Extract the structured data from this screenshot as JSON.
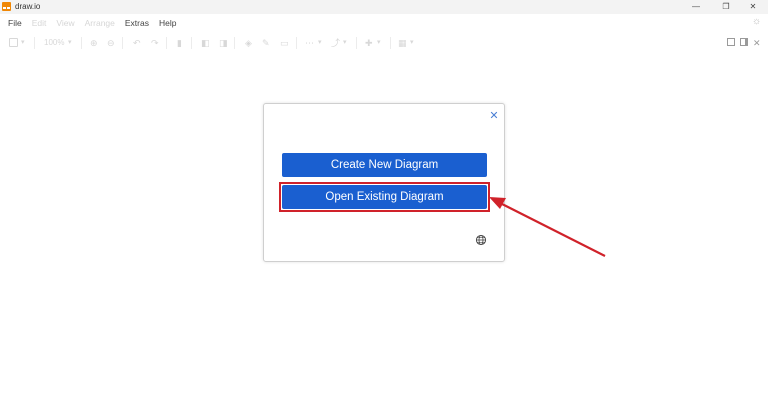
{
  "window": {
    "title": "draw.io",
    "controls": {
      "minimize": "—",
      "maximize": "❐",
      "close": "✕"
    }
  },
  "menubar": {
    "items": [
      {
        "label": "File",
        "enabled": true
      },
      {
        "label": "Edit",
        "enabled": false
      },
      {
        "label": "View",
        "enabled": false
      },
      {
        "label": "Arrange",
        "enabled": false
      },
      {
        "label": "Extras",
        "enabled": true
      },
      {
        "label": "Help",
        "enabled": true
      }
    ]
  },
  "toolbar": {
    "zoom_label": "100%"
  },
  "dialog": {
    "close_glyph": "✕",
    "create_label": "Create New Diagram",
    "open_label": "Open Existing Diagram",
    "language_icon": "globe-icon"
  },
  "colors": {
    "primary_button": "#1a5fd0",
    "annotation": "#d0222a",
    "close_icon": "#4a7fd4",
    "app_logo": "#f08705"
  }
}
